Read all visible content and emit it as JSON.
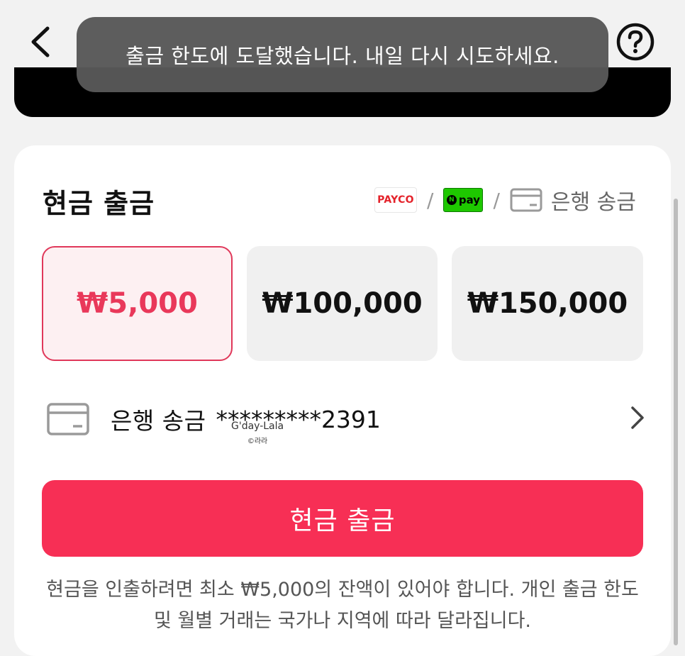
{
  "toast": {
    "message": "출금 한도에 도달했습니다. 내일 다시 시도하세요."
  },
  "header": {
    "back_icon": "chevron-left-icon",
    "help_icon": "question-circle-icon"
  },
  "withdraw": {
    "title": "현금 출금",
    "methods": {
      "payco": "PAYCO",
      "npay": "pay",
      "npay_badge": "N",
      "separator": "/",
      "bank": "은행 송금"
    },
    "amounts": [
      {
        "label": "₩5,000",
        "selected": true
      },
      {
        "label": "₩100,000",
        "selected": false
      },
      {
        "label": "₩150,000",
        "selected": false
      }
    ],
    "account": {
      "label": "은행 송금",
      "number": "*********2391"
    },
    "watermark": {
      "line1": "G'day-Lala",
      "line2": "©라라"
    },
    "button_label": "현금 출금",
    "notice": "현금을 인출하려면 최소 ₩5,000의 잔액이 있어야 합니다. 개인 출금 한도 및 월별 거래는 국가나 지역에 따라 달라집니다."
  },
  "colors": {
    "accent": "#f72f55",
    "selected_text": "#e9385a",
    "selected_bg": "#fdf0f2"
  }
}
